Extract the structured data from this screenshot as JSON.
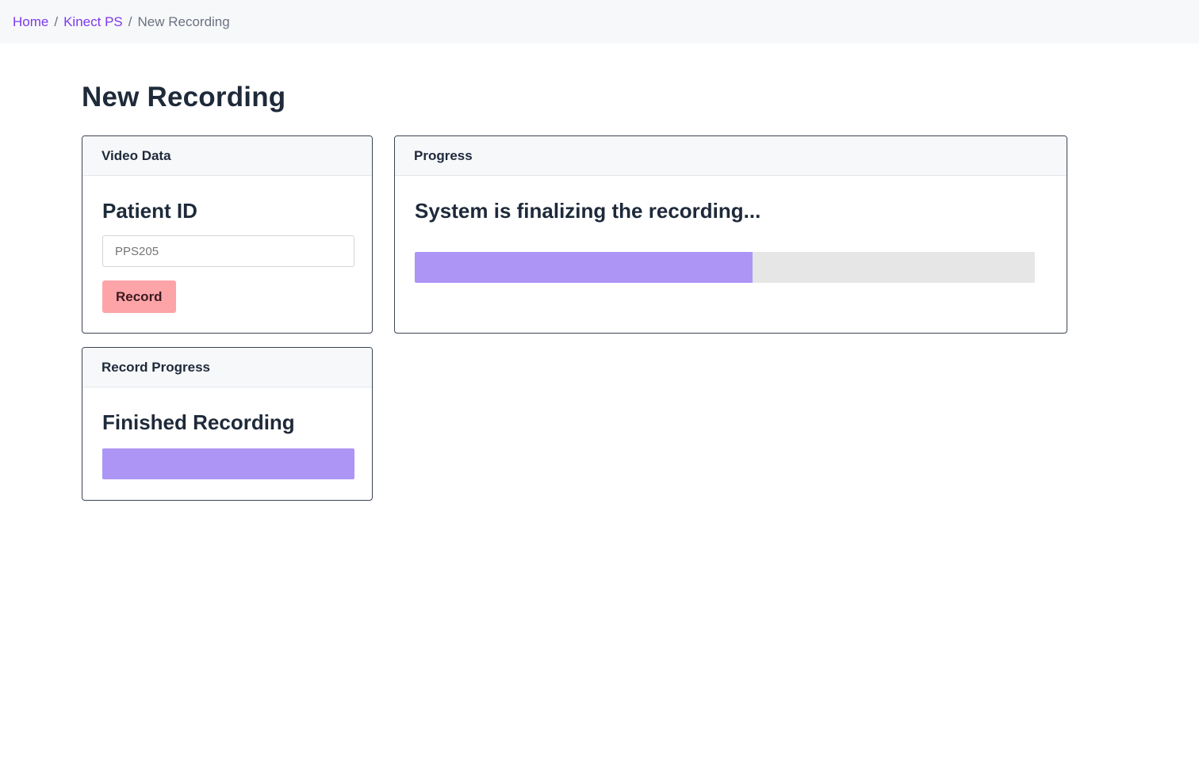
{
  "breadcrumb": {
    "items": [
      {
        "label": "Home",
        "link": true
      },
      {
        "label": "Kinect PS",
        "link": true
      },
      {
        "label": "New Recording",
        "link": false
      }
    ],
    "separator": "/"
  },
  "page": {
    "title": "New Recording"
  },
  "video_data": {
    "header": "Video Data",
    "patient_label": "Patient ID",
    "patient_value": "",
    "patient_placeholder": "PPS205",
    "record_label": "Record",
    "record_color": "#fda4a8"
  },
  "progress": {
    "header": "Progress",
    "status_text": "System is finalizing the recording...",
    "percent": 54.5,
    "fill_color": "#ac95f5",
    "track_color": "#e6e6e6"
  },
  "record_progress": {
    "header": "Record Progress",
    "status_text": "Finished Recording",
    "percent": 100,
    "fill_color": "#ac95f5"
  },
  "colors": {
    "link": "#7c3aed",
    "border": "#3b4453",
    "text": "#1e2a3a"
  }
}
